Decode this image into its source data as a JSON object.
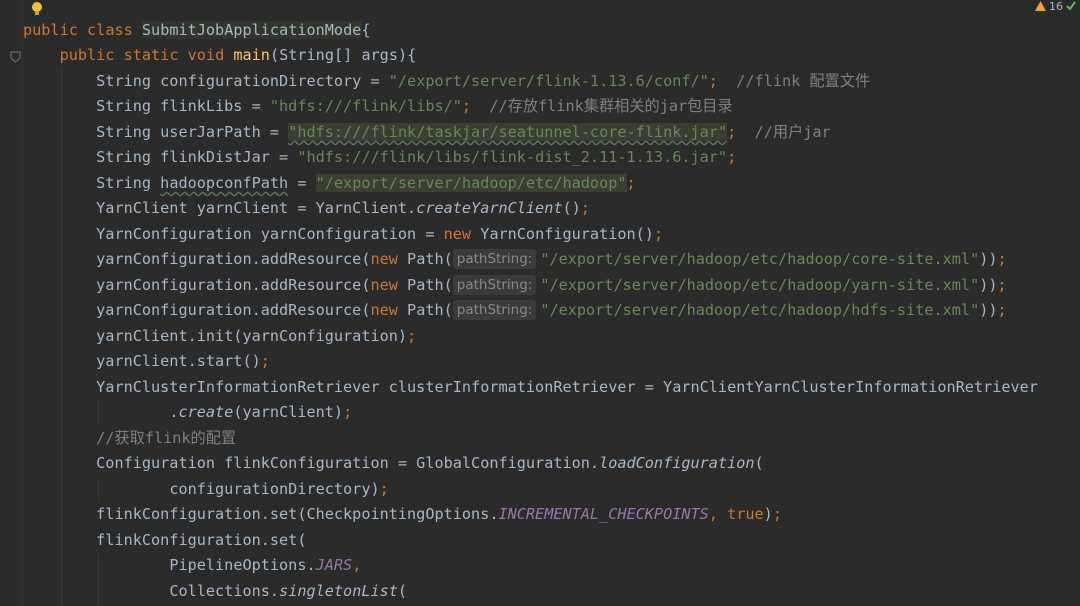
{
  "inspections": {
    "warnings": "16"
  },
  "code": {
    "l1": {
      "kw1": "public",
      "kw2": "class",
      "name": "SubmitJobApplicationMode",
      "brace": "{"
    },
    "l2": {
      "kw1": "public",
      "kw2": "static",
      "kw3": "void",
      "fn": "main",
      "rest": "(String[] args){"
    },
    "l3": {
      "decl": "String configurationDirectory = ",
      "str": "\"/export/server/flink-1.13.6/conf/\"",
      "semi": ";",
      "comment": "//flink 配置文件"
    },
    "l4": {
      "decl": "String flinkLibs = ",
      "str": "\"hdfs:///flink/libs/\"",
      "semi": ";",
      "comment": "//存放flink集群相关的jar包目录"
    },
    "l5": {
      "decl": "String userJarPath = ",
      "str": "\"hdfs:///flink/taskjar/seatunnel-core-flink.jar\"",
      "semi": ";",
      "comment": "//用户jar"
    },
    "l6": {
      "decl": "String flinkDistJar = ",
      "str": "\"hdfs:///flink/libs/flink-dist_2.11-1.13.6.jar\"",
      "semi": ";"
    },
    "l7": {
      "type": "String ",
      "var": "hadoopconfPath",
      "eq": " = ",
      "str": "\"/export/server/hadoop/etc/hadoop\"",
      "semi": ";"
    },
    "l8": {
      "decl": "YarnClient yarnClient = YarnClient.",
      "call": "createYarnClient",
      "paren": "()",
      "semi": ";"
    },
    "l9": {
      "decl": "YarnConfiguration yarnConfiguration = ",
      "kw": "new",
      "rest": " YarnConfiguration()",
      "semi": ";"
    },
    "l10": {
      "pre": "yarnConfiguration.addResource(",
      "kw": "new",
      "path": " Path(",
      "hint": "pathString:",
      "str": "\"/export/server/hadoop/etc/hadoop/core-site.xml\"",
      "close": "))",
      "semi": ";"
    },
    "l11": {
      "pre": "yarnConfiguration.addResource(",
      "kw": "new",
      "path": " Path(",
      "hint": "pathString:",
      "str": "\"/export/server/hadoop/etc/hadoop/yarn-site.xml\"",
      "close": "))",
      "semi": ";"
    },
    "l12": {
      "pre": "yarnConfiguration.addResource(",
      "kw": "new",
      "path": " Path(",
      "hint": "pathString:",
      "str": "\"/export/server/hadoop/etc/hadoop/hdfs-site.xml\"",
      "close": "))",
      "semi": ";"
    },
    "l13": {
      "text": "yarnClient.init(yarnConfiguration)",
      "semi": ";"
    },
    "l14": {
      "text": "yarnClient.start()",
      "semi": ";"
    },
    "l15": {
      "text": "YarnClusterInformationRetriever clusterInformationRetriever = YarnClientYarnClusterInformationRetriever"
    },
    "l16": {
      "dot": ".",
      "call": "create",
      "rest": "(yarnClient)",
      "semi": ";"
    },
    "l17": {
      "comment": "//获取flink的配置"
    },
    "l18": {
      "decl": "Configuration flinkConfiguration = GlobalConfiguration.",
      "call": "loadConfiguration",
      "rest": "("
    },
    "l19": {
      "text": "configurationDirectory)",
      "semi": ";"
    },
    "l20": {
      "pre": "flinkConfiguration.set(CheckpointingOptions.",
      "const": "INCREMENTAL_CHECKPOINTS",
      "comma": ", ",
      "kw": "true",
      "close": ")",
      "semi": ";"
    },
    "l21": {
      "text": "flinkConfiguration.set("
    },
    "l22": {
      "pre": "PipelineOptions.",
      "const": "JARS",
      "comma": ","
    },
    "l23": {
      "pre": "Collections.",
      "call": "singletonList",
      "rest": "("
    }
  }
}
